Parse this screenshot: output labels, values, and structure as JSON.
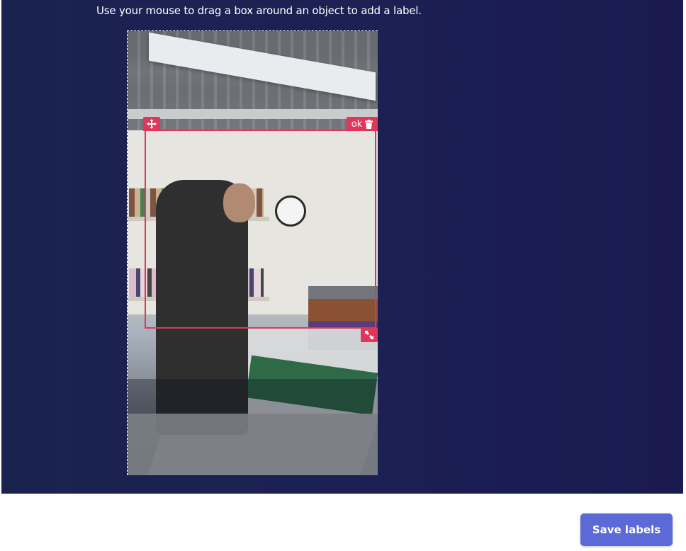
{
  "instructions": "Use your mouse to drag a box around an object to add a label.",
  "image": {
    "alt_semantic": "labeling-photo"
  },
  "bounding_boxes": [
    {
      "label": "ok",
      "move_icon": "move-arrows-icon",
      "delete_icon": "trash-icon",
      "resize_icon": "resize-diagonal-icon",
      "color": "#e0365b"
    }
  ],
  "actions": {
    "save_label": "Save labels"
  },
  "colors": {
    "panel_background": "#1c2153",
    "accent": "#e0365b",
    "save_button": "#5c6ad8"
  }
}
